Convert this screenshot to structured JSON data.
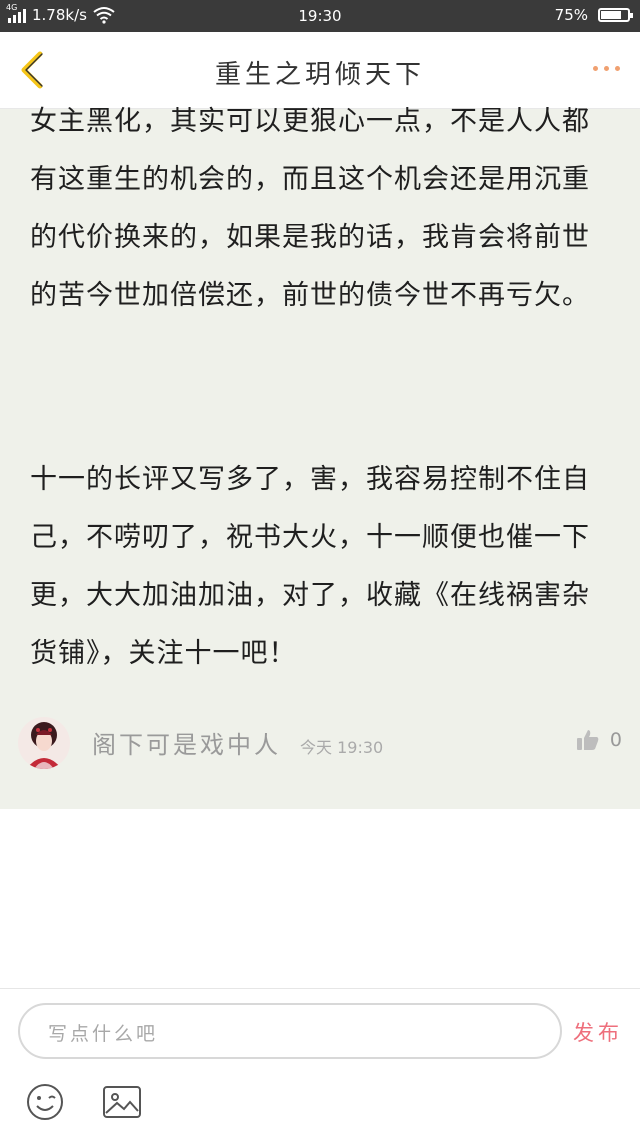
{
  "status_bar": {
    "network": "4G",
    "speed": "1.78k/s",
    "time": "19:30",
    "battery": "75%",
    "battery_level": 0.75
  },
  "header": {
    "title": "重生之玥倾天下"
  },
  "paragraphs": [
    "女主黑化，其实可以更狠心一点，不是人人都有这重生的机会的，而且这个机会还是用沉重的代价换来的，如果是我的话，我肯会将前世的苦今世加倍偿还，前世的债今世不再亏欠。",
    "十一的长评又写多了，害，我容易控制不住自己，不唠叨了，祝书大火，十一顺便也催一下更，大大加油加油，对了，收藏《在线祸害杂货铺》，关注十一吧！"
  ],
  "comment": {
    "author": "阁下可是戏中人",
    "time": "今天 19:30",
    "likes": "0"
  },
  "input": {
    "placeholder": "写点什么吧",
    "publish_label": "发布"
  },
  "colors": {
    "content_bg": "#eff1ea",
    "back_accent": "#f5c518",
    "more_dots": "#f0a070",
    "publish": "#ee6f7c"
  },
  "icons": [
    "back-arrow-icon",
    "more-icon",
    "like-icon",
    "emoji-icon",
    "image-icon",
    "wifi-icon",
    "battery-icon"
  ]
}
